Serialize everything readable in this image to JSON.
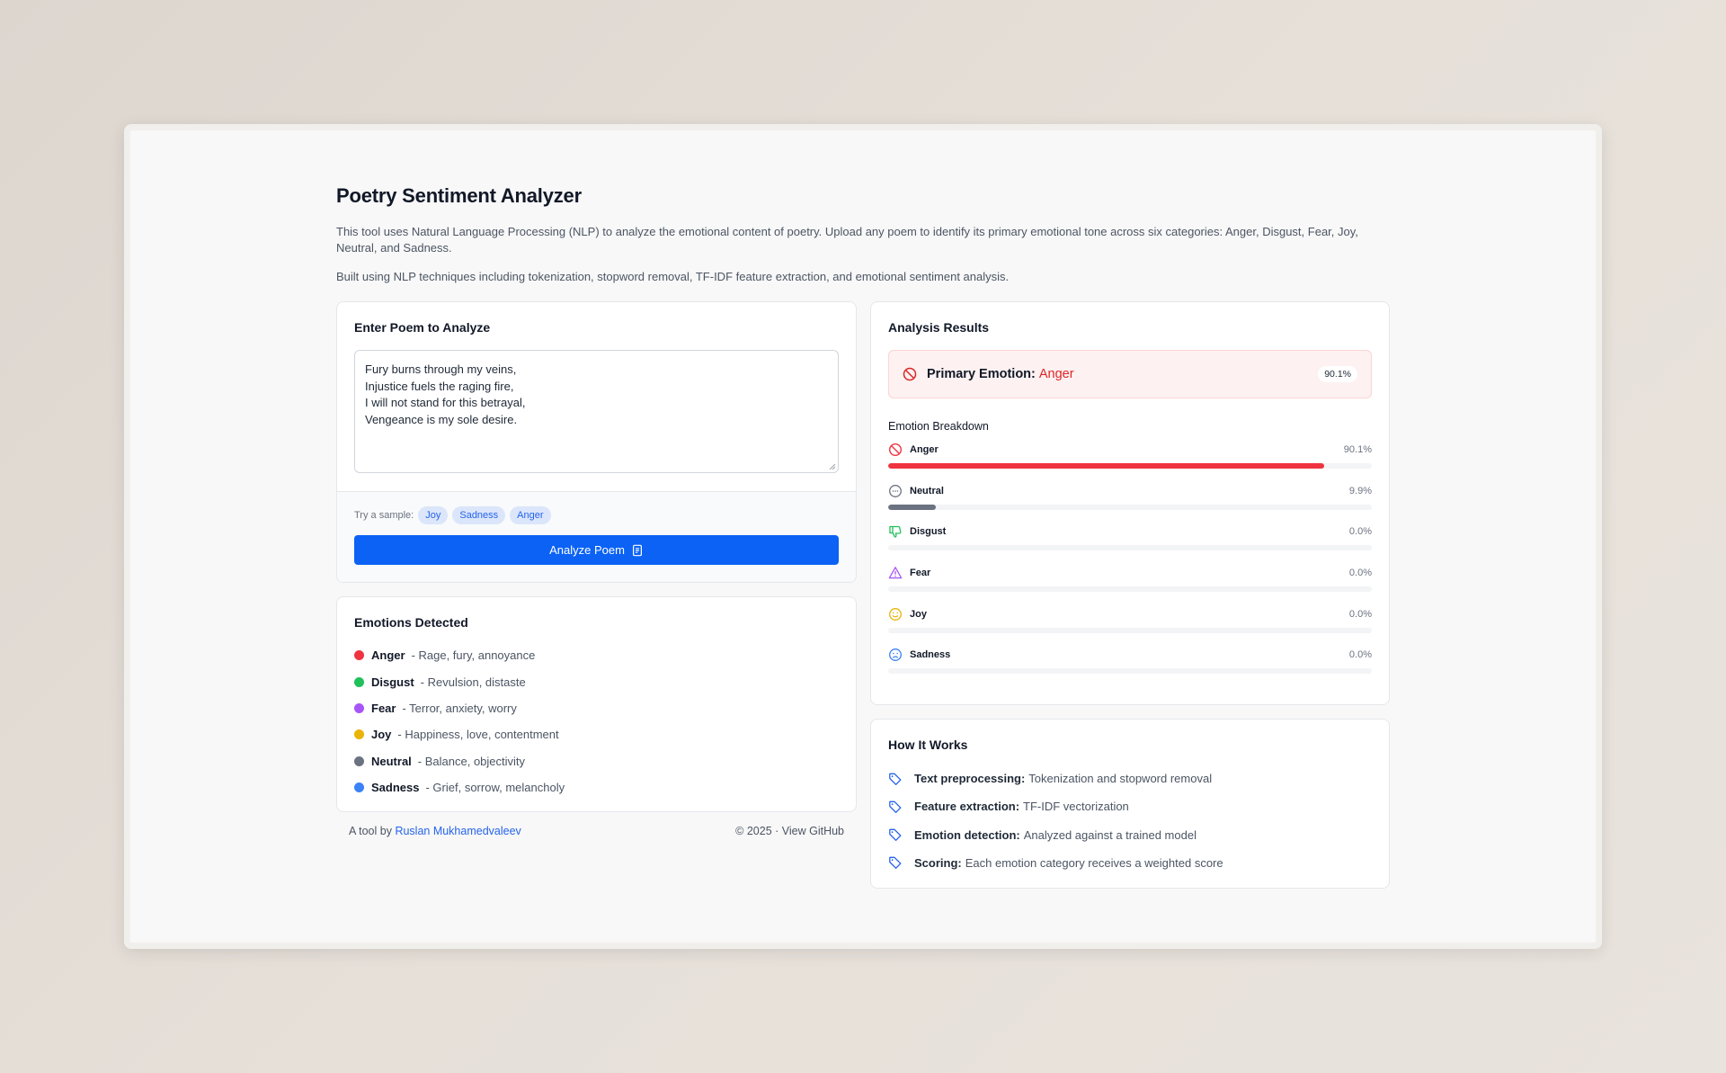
{
  "title": "Poetry Sentiment Analyzer",
  "intro": [
    "This tool uses Natural Language Processing (NLP) to analyze the emotional content of poetry. Upload any poem to identify its primary emotional tone across six categories: Anger, Disgust, Fear, Joy, Neutral, and Sadness.",
    "Built using NLP techniques including tokenization, stopword removal, TF-IDF feature extraction, and emotional sentiment analysis."
  ],
  "input": {
    "title": "Enter Poem to Analyze",
    "poem": [
      "Fury burns through my veins,",
      "Injustice fuels the raging fire,",
      "I will not stand for this betrayal,",
      "Vengeance is my sole desire."
    ],
    "samples_label": "Try a sample:",
    "samples": [
      "Joy",
      "Sadness",
      "Anger"
    ],
    "analyze_label": "Analyze Poem"
  },
  "emotions": {
    "title": "Emotions Detected",
    "items": [
      {
        "name": "Anger",
        "desc": "- Rage, fury, annoyance",
        "color": "#ef3340"
      },
      {
        "name": "Disgust",
        "desc": "- Revulsion, distaste",
        "color": "#20c05a"
      },
      {
        "name": "Fear",
        "desc": "- Terror, anxiety, worry",
        "color": "#a855f7"
      },
      {
        "name": "Joy",
        "desc": "- Happiness, love, contentment",
        "color": "#eab308"
      },
      {
        "name": "Neutral",
        "desc": "- Balance, objectivity",
        "color": "#6b7280"
      },
      {
        "name": "Sadness",
        "desc": "- Grief, sorrow, melancholy",
        "color": "#3b82f6"
      }
    ]
  },
  "footer": {
    "prefix": "A tool by",
    "author": "Ruslan Mukhamedvaleev",
    "right": "© 2025 · View GitHub"
  },
  "results": {
    "title": "Analysis Results",
    "primary_label": "Primary Emotion:",
    "primary_value": "Anger",
    "primary_pct": "90.1%",
    "breakdown_title": "Emotion Breakdown",
    "breakdown": [
      {
        "name": "Anger",
        "pct": "90.1%",
        "value": 0.901,
        "color": "#ef3340",
        "icon": "ban-icon"
      },
      {
        "name": "Neutral",
        "pct": "9.9%",
        "value": 0.099,
        "color": "#6b7280",
        "icon": "meh-icon"
      },
      {
        "name": "Disgust",
        "pct": "0.0%",
        "value": 0,
        "color": "#20c05a",
        "icon": "thumbs-down-icon"
      },
      {
        "name": "Fear",
        "pct": "0.0%",
        "value": 0,
        "color": "#a855f7",
        "icon": "warning-icon"
      },
      {
        "name": "Joy",
        "pct": "0.0%",
        "value": 0,
        "color": "#eab308",
        "icon": "smile-icon"
      },
      {
        "name": "Sadness",
        "pct": "0.0%",
        "value": 0,
        "color": "#3b82f6",
        "icon": "frown-icon"
      }
    ]
  },
  "how": {
    "title": "How It Works",
    "items": [
      {
        "key": "Text preprocessing:",
        "text": "Tokenization and stopword removal"
      },
      {
        "key": "Feature extraction:",
        "text": "TF-IDF vectorization"
      },
      {
        "key": "Emotion detection:",
        "text": "Analyzed against a trained model"
      },
      {
        "key": "Scoring:",
        "text": "Each emotion category receives a weighted score"
      }
    ]
  }
}
